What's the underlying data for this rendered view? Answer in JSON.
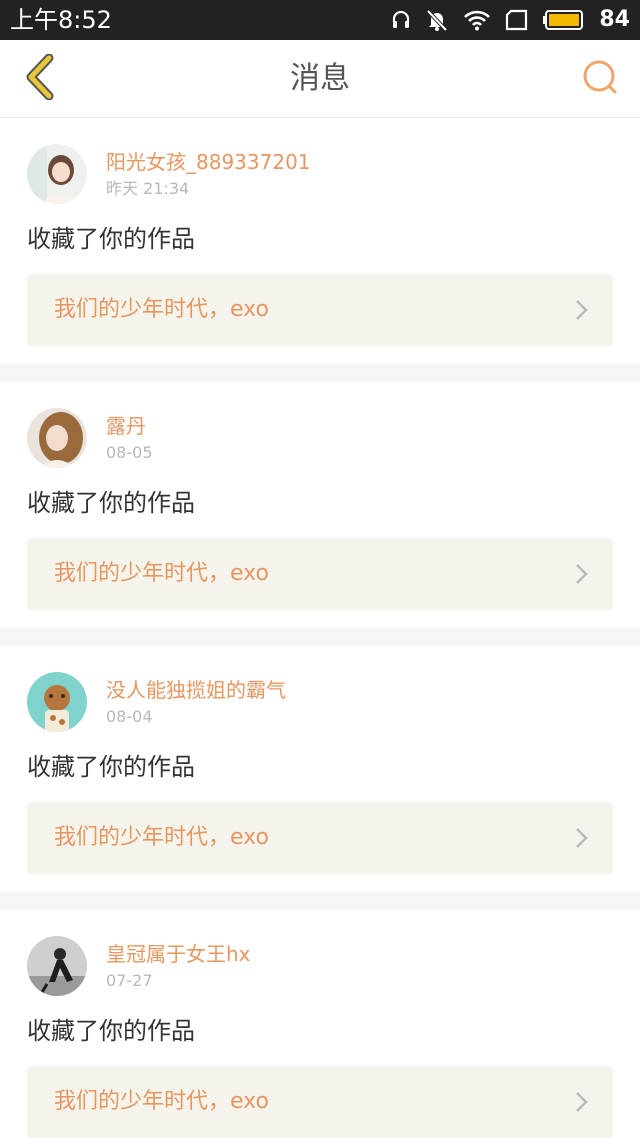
{
  "status_bar": {
    "time": "上午8:52",
    "battery": "84"
  },
  "header": {
    "title": "消息"
  },
  "colors": {
    "accent": "#e8965f",
    "back_arrow": "#e7c638",
    "link_bg": "#f4f4ec",
    "status_bar_bg": "#222222"
  },
  "notifications": [
    {
      "user": "阳光女孩_889337201",
      "time": "昨天 21:34",
      "action": "收藏了你的作品",
      "work_title": "我们的少年时代，exo"
    },
    {
      "user": "露丹",
      "time": "08-05",
      "action": "收藏了你的作品",
      "work_title": "我们的少年时代，exo"
    },
    {
      "user": "没人能独揽姐的霸气",
      "time": "08-04",
      "action": "收藏了你的作品",
      "work_title": "我们的少年时代，exo"
    },
    {
      "user": "皇冠属于女王hx",
      "time": "07-27",
      "action": "收藏了你的作品",
      "work_title": "我们的少年时代，exo"
    }
  ]
}
